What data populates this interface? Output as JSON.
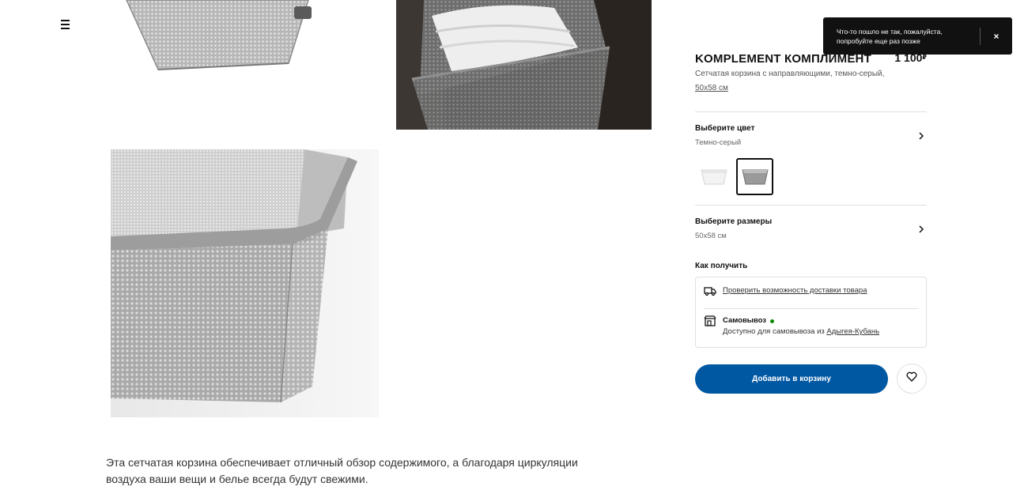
{
  "product": {
    "name": "KOMPLEMENT КОМПЛИМЕНТ",
    "price": "1 100",
    "currency": "₽",
    "subtitle": "Сетчатая корзина с направляющими, темно-серый,",
    "size_link": "50x58 см"
  },
  "color_select": {
    "label": "Выберите цвет",
    "value": "Темно-серый"
  },
  "size_select": {
    "label": "Выберите размеры",
    "value": "50x58 см"
  },
  "delivery": {
    "heading": "Как получить",
    "check_link": "Проверить возможность доставки товара",
    "pickup_title": "Самовывоз",
    "pickup_text": "Доступно для самовывоза из",
    "pickup_store": "Адыгея-Кубань"
  },
  "actions": {
    "add_to_cart": "Добавить в корзину"
  },
  "description": "Эта сетчатая корзина обеспечивает отличный обзор содержимого, а благодаря циркуляции воздуха ваши вещи и белье всегда будут свежими.",
  "toast": {
    "message": "Что-то пошло не так, пожалуйста, попробуйте еще раз позже",
    "close": "×"
  },
  "icons": {
    "menu": "hamburger-menu-icon",
    "chevron": "chevron-right-icon",
    "truck": "truck-icon",
    "store": "store-icon",
    "heart": "heart-icon"
  },
  "colors": {
    "accent": "#0058a3",
    "toast_bg": "#111111",
    "stock_green": "#0a8a00"
  }
}
